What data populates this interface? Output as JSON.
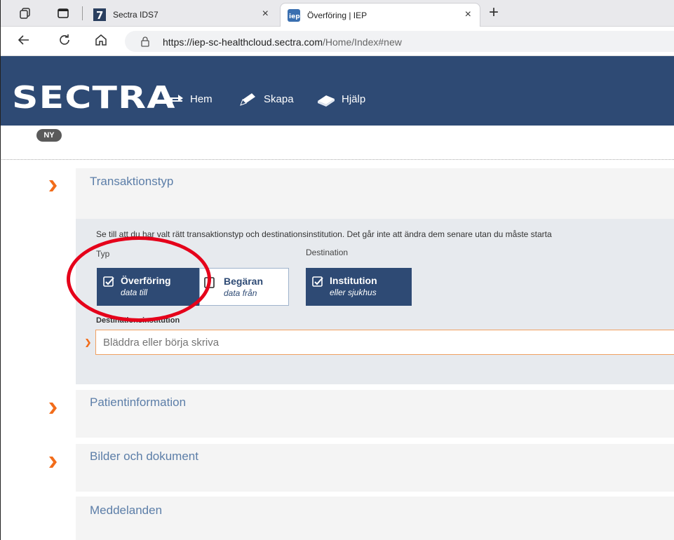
{
  "browser": {
    "tabs": [
      {
        "title": "Sectra IDS7",
        "active": false
      },
      {
        "title": "Överföring | IEP",
        "active": true
      }
    ],
    "tab_close_glyph": "×",
    "new_tab_glyph": "+",
    "url_host": "https://iep-sc-healthcloud.sectra.com",
    "url_path": "/Home/Index#new"
  },
  "app": {
    "logo_text": "SECTRA",
    "nav": [
      {
        "label": "Hem",
        "icon": "transfer-arrows-icon"
      },
      {
        "label": "Skapa",
        "icon": "pencil-icon"
      },
      {
        "label": "Hjälp",
        "icon": "book-icon"
      }
    ],
    "status_badge": "NY"
  },
  "sections": {
    "transaktionstyp": {
      "title": "Transaktionstyp",
      "info": "Se till att du har valt rätt transaktionstyp och destinationsinstitution. Det går inte att ändra dem senare utan du måste starta",
      "typ_label": "Typ",
      "destination_label": "Destination",
      "options": {
        "overforing": {
          "title": "Överföring",
          "subtitle": "data till",
          "checked": true
        },
        "begaran": {
          "title": "Begäran",
          "subtitle": "data från",
          "checked": false
        },
        "institution": {
          "title": "Institution",
          "subtitle": "eller sjukhus",
          "checked": true
        }
      },
      "destinationsinstitution_label": "Destinationsinstitution",
      "destinationsinstitution_placeholder": "Bläddra eller börja skriva"
    },
    "patientinformation": {
      "title": "Patientinformation"
    },
    "bilder": {
      "title": "Bilder och dokument"
    },
    "meddelanden": {
      "title": "Meddelanden"
    }
  },
  "colors": {
    "header": "#2e4a74",
    "accent_orange": "#f26c1a",
    "highlight_red": "#e5001a",
    "section_title": "#5c7ea8"
  }
}
